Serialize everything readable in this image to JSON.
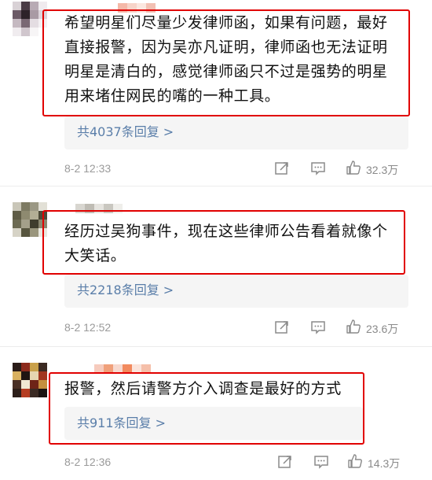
{
  "comments": [
    {
      "lines": [
        "希望明星们尽量少发律师函，如果有问题，最好",
        "直接报警，因为吴亦凡证明，律师函也无法证明",
        "明星是清白的，感觉律师函只不过是强势的明星",
        "用来堵住网民的嘴的一种工具。"
      ],
      "reply_link": "共4037条回复 >",
      "time": "8-2 12:33",
      "likes": "32.3万"
    },
    {
      "lines": [
        "经历过吴狗事件，现在这些律师公告看着就像个",
        "大笑话。"
      ],
      "reply_link": "共2218条回复 >",
      "time": "8-2 12:52",
      "likes": "23.6万"
    },
    {
      "lines": [
        "报警，然后请警方介入调查是最好的方式"
      ],
      "reply_link": "共911条回复 >",
      "time": "8-2 12:36",
      "likes": "14.3万"
    }
  ],
  "icons": {
    "share": "share-icon",
    "comment": "comment-icon",
    "like": "like-icon"
  },
  "colors": {
    "highlight_frame": "#e10000",
    "reply_link": "#5a7ea9",
    "meta": "#9a9a9a"
  }
}
